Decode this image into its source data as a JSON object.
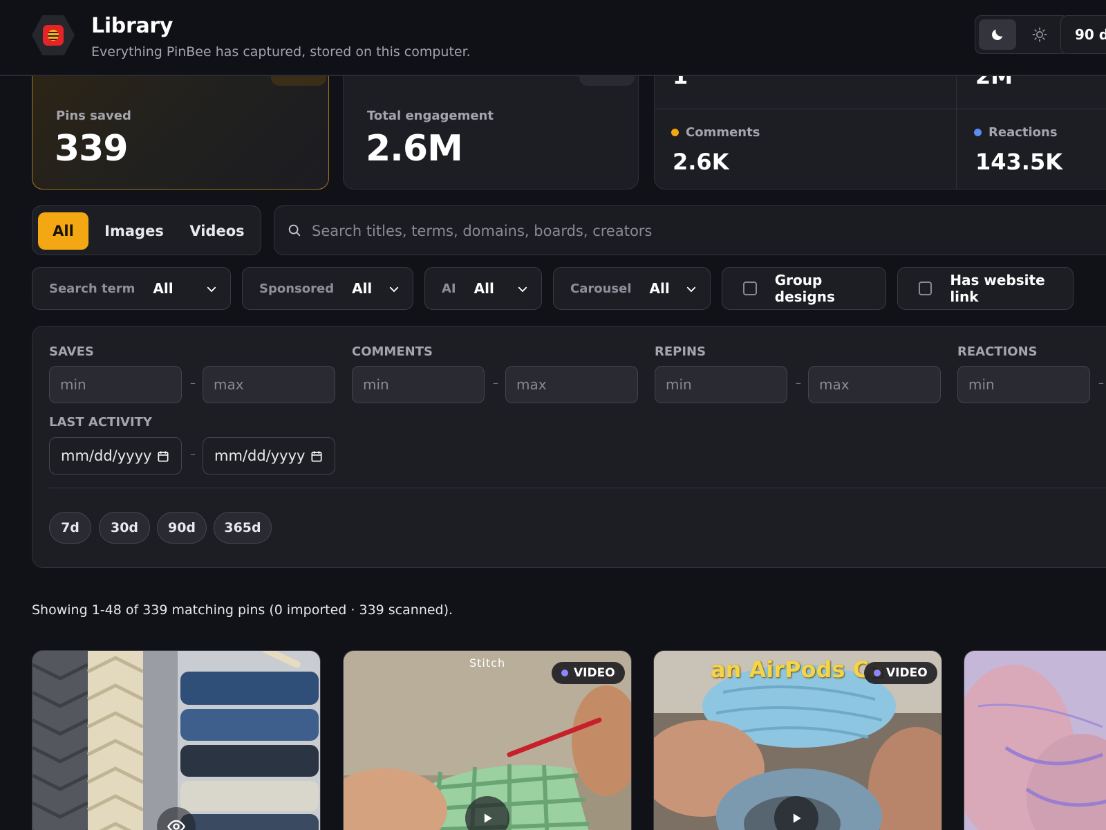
{
  "header": {
    "title": "Library",
    "subtitle": "Everything PinBee has captured, stored on this computer.",
    "range_label": "90 d",
    "accent": "#f3a712"
  },
  "stats": {
    "pins_saved": {
      "label": "Pins saved",
      "value": "339"
    },
    "total_engagement": {
      "label": "Total engagement",
      "value": "2.6M"
    },
    "breakdown_top": [
      "1",
      "2M"
    ],
    "comments": {
      "label": "Comments",
      "value": "2.6K",
      "color": "#f3a712"
    },
    "reactions": {
      "label": "Reactions",
      "value": "143.5K",
      "color": "#5b8cf0"
    }
  },
  "type_filter": {
    "options": [
      "All",
      "Images",
      "Videos"
    ],
    "active": "All"
  },
  "search": {
    "placeholder": "Search titles, terms, domains, boards, creators",
    "value": ""
  },
  "filters": [
    {
      "label": "Search term",
      "value": "All"
    },
    {
      "label": "Sponsored",
      "value": "All"
    },
    {
      "label": "AI",
      "value": "All"
    },
    {
      "label": "Carousel",
      "value": "All"
    }
  ],
  "checkboxes": [
    {
      "label": "Group designs",
      "checked": false
    },
    {
      "label": "Has website link",
      "checked": false
    }
  ],
  "ranges": {
    "saves": "SAVES",
    "comments": "COMMENTS",
    "repins": "REPINS",
    "reactions": "REACTIONS",
    "min_placeholder": "min",
    "max_placeholder": "max",
    "dash": "–",
    "last_activity": "LAST ACTIVITY",
    "date_placeholder": "mm/dd/yyyy",
    "quick_ranges": [
      "7d",
      "30d",
      "90d",
      "365d"
    ]
  },
  "summary": "Showing 1-48 of 339 matching pins (0 imported · 339 scanned).",
  "pins": [
    {
      "kind": "image",
      "overlay": ""
    },
    {
      "kind": "video",
      "badge": "VIDEO",
      "overlay": "Stitch"
    },
    {
      "kind": "video",
      "badge": "VIDEO",
      "overlay": "an AirPods Ca"
    },
    {
      "kind": "video",
      "overlay": ""
    }
  ]
}
